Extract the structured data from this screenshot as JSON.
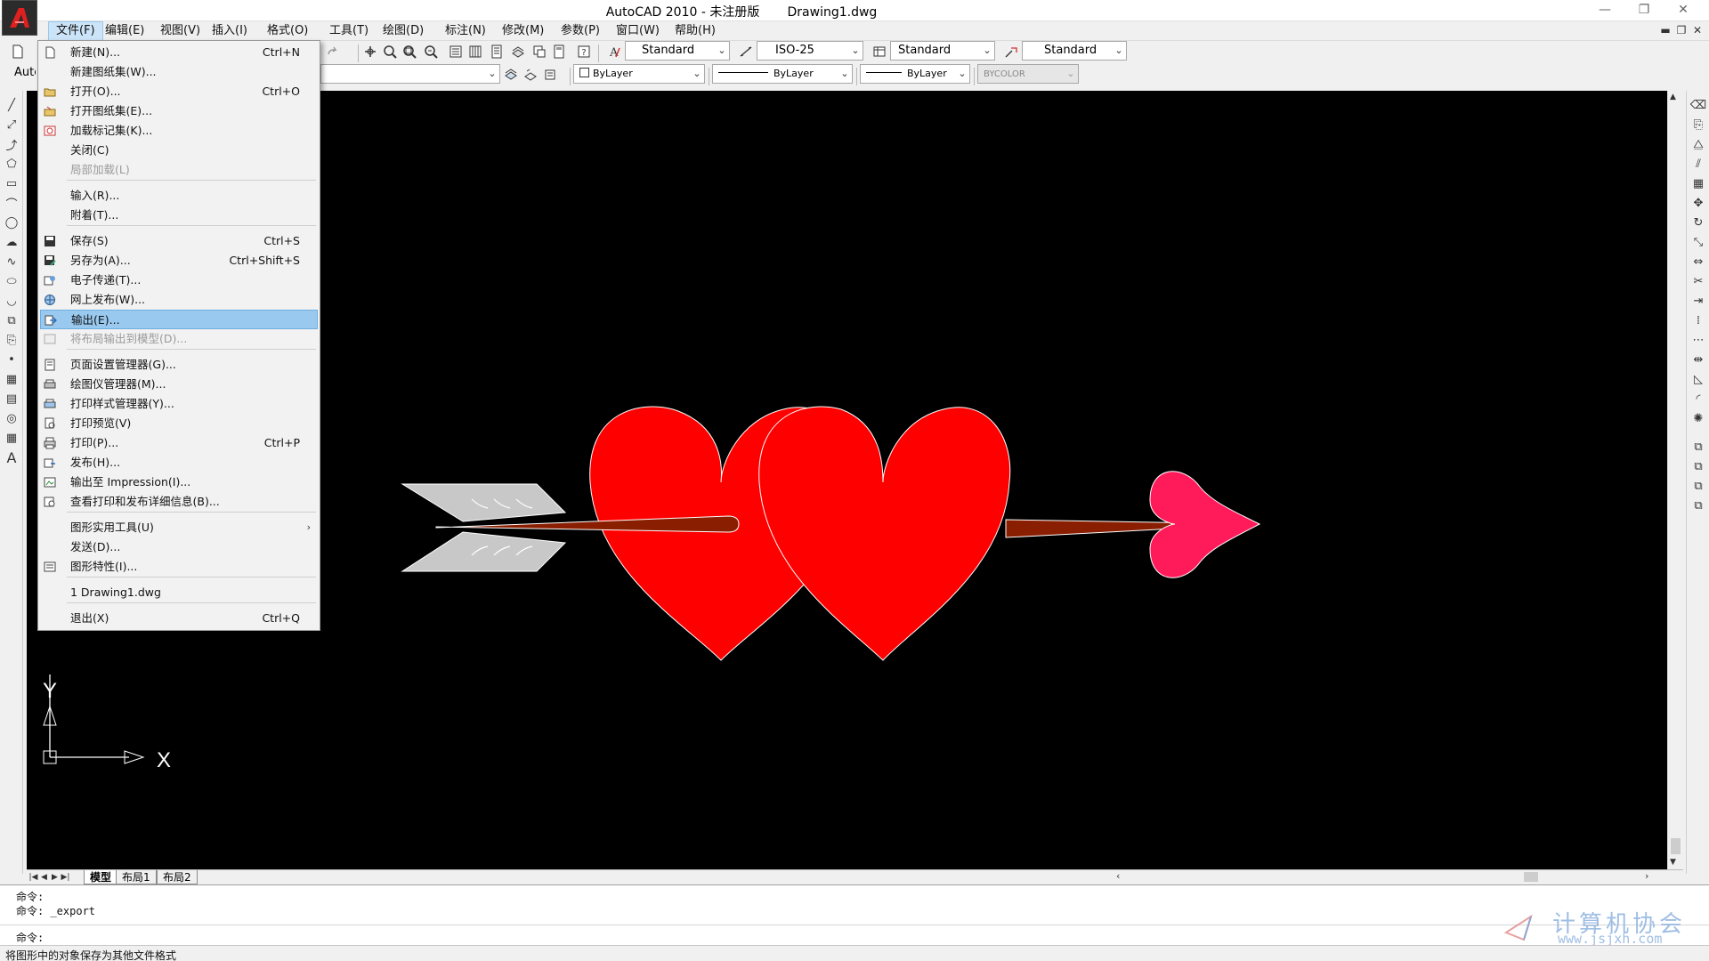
{
  "app": {
    "title": "AutoCAD 2010 - 未注册版",
    "document": "Drawing1.dwg",
    "logo_letter": "A"
  },
  "window_controls": {
    "minimize": "—",
    "restore": "❐",
    "close": "✕"
  },
  "doc_controls": {
    "minimize": "▬",
    "restore": "❐",
    "close": "✕"
  },
  "menubar": {
    "items": [
      "文件(F)",
      "编辑(E)",
      "视图(V)",
      "插入(I)",
      "格式(O)",
      "工具(T)",
      "绘图(D)",
      "标注(N)",
      "修改(M)",
      "参数(P)",
      "窗口(W)",
      "帮助(H)"
    ],
    "active_index": 0
  },
  "toolbar_styles": {
    "text_style": "Standard",
    "dim_style": "ISO-25",
    "table_style": "Standard",
    "multileader_style": "Standard"
  },
  "toolbar_props": {
    "workspace_partial": "Autc",
    "color": "ByLayer",
    "linetype": "ByLayer",
    "lineweight": "ByLayer",
    "plotstyle": "BYCOLOR"
  },
  "file_menu": {
    "items": [
      {
        "label": "新建(N)...",
        "shortcut": "Ctrl+N",
        "icon": "new-file-icon"
      },
      {
        "label": "新建图纸集(W)...",
        "shortcut": "",
        "icon": ""
      },
      {
        "label": "打开(O)...",
        "shortcut": "Ctrl+O",
        "icon": "open-folder-icon"
      },
      {
        "label": "打开图纸集(E)...",
        "shortcut": "",
        "icon": "open-sheet-set-icon"
      },
      {
        "label": "加载标记集(K)...",
        "shortcut": "",
        "icon": "markup-set-icon"
      },
      {
        "label": "关闭(C)",
        "shortcut": "",
        "icon": ""
      },
      {
        "label": "局部加载(L)",
        "shortcut": "",
        "icon": "",
        "disabled": true
      },
      {
        "label": "输入(R)...",
        "shortcut": "",
        "icon": ""
      },
      {
        "label": "附着(T)...",
        "shortcut": "",
        "icon": ""
      },
      {
        "label": "保存(S)",
        "shortcut": "Ctrl+S",
        "icon": "save-disk-icon"
      },
      {
        "label": "另存为(A)...",
        "shortcut": "Ctrl+Shift+S",
        "icon": "save-as-icon"
      },
      {
        "label": "电子传递(T)...",
        "shortcut": "",
        "icon": "etransmit-icon"
      },
      {
        "label": "网上发布(W)...",
        "shortcut": "",
        "icon": "publish-web-icon"
      },
      {
        "label": "输出(E)...",
        "shortcut": "",
        "icon": "export-icon",
        "highlighted": true
      },
      {
        "label": "将布局输出到模型(D)...",
        "shortcut": "",
        "icon": "layout-to-model-icon",
        "disabled": true
      },
      {
        "label": "页面设置管理器(G)...",
        "shortcut": "",
        "icon": "page-setup-icon"
      },
      {
        "label": "绘图仪管理器(M)...",
        "shortcut": "",
        "icon": "plotter-manager-icon"
      },
      {
        "label": "打印样式管理器(Y)...",
        "shortcut": "",
        "icon": "plot-style-icon"
      },
      {
        "label": "打印预览(V)",
        "shortcut": "",
        "icon": "plot-preview-icon"
      },
      {
        "label": "打印(P)...",
        "shortcut": "Ctrl+P",
        "icon": "printer-icon"
      },
      {
        "label": "发布(H)...",
        "shortcut": "",
        "icon": "publish-icon"
      },
      {
        "label": "输出至 Impression(I)...",
        "shortcut": "",
        "icon": "impression-icon"
      },
      {
        "label": "查看打印和发布详细信息(B)...",
        "shortcut": "",
        "icon": "plot-details-icon"
      },
      {
        "label": "图形实用工具(U)",
        "shortcut": "",
        "icon": "",
        "submenu": true
      },
      {
        "label": "发送(D)...",
        "shortcut": "",
        "icon": ""
      },
      {
        "label": "图形特性(I)...",
        "shortcut": "",
        "icon": "drawing-properties-icon"
      },
      {
        "label": "1 Drawing1.dwg",
        "shortcut": "",
        "icon": ""
      },
      {
        "label": "退出(X)",
        "shortcut": "Ctrl+Q",
        "icon": ""
      }
    ]
  },
  "layout_tabs": [
    "模型",
    "布局1",
    "布局2"
  ],
  "ucs": {
    "x_label": "X",
    "y_label": "Y"
  },
  "command_lines": [
    "命令:",
    "命令: _export",
    "命令:"
  ],
  "status_text": "将图形中的对象保存为其他文件格式",
  "watermark": {
    "cn": "计算机协会",
    "url": "www.jsjxh.com"
  },
  "colors": {
    "canvas": "#000000",
    "heart": "#ff0000",
    "arrow_shaft": "#8a1e00",
    "fletching": "#c8c8c8",
    "arrowhead": "#ff1a5a",
    "menu_highlight": "#99c9ef"
  }
}
